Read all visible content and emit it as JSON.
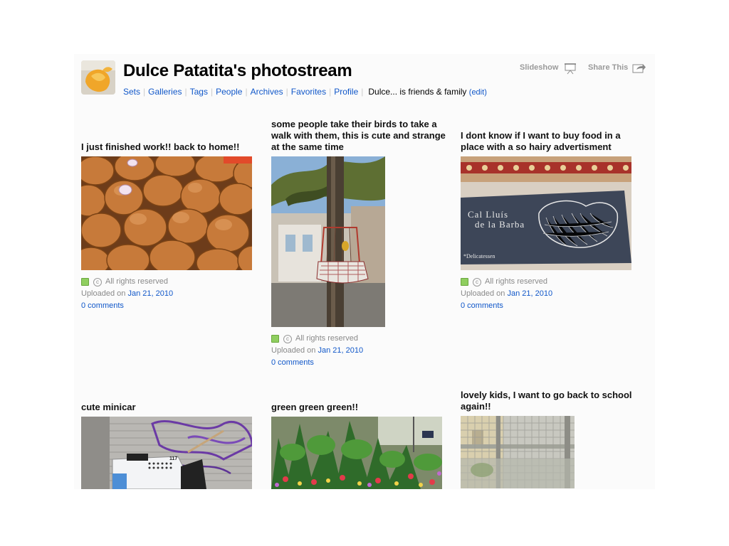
{
  "header": {
    "title": "Dulce Patatita's photostream",
    "nav": [
      "Sets",
      "Galleries",
      "Tags",
      "People",
      "Archives",
      "Favorites",
      "Profile"
    ],
    "relationship": "Dulce... is friends & family",
    "edit_label": "edit",
    "slideshow_label": "Slideshow",
    "share_label": "Share This"
  },
  "photos": [
    {
      "title": "I just finished work!! back to home!!",
      "rights": "All rights reserved",
      "uploaded_prefix": "Uploaded on",
      "uploaded_date": "Jan 21, 2010",
      "comments": "0 comments"
    },
    {
      "title": "some people take their birds to take a walk with them, this is cute and strange at the same time",
      "rights": "All rights reserved",
      "uploaded_prefix": "Uploaded on",
      "uploaded_date": "Jan 21, 2010",
      "comments": "0 comments"
    },
    {
      "title": "I dont know if I want to buy food in a place with a so hairy advertisment",
      "rights": "All rights reserved",
      "uploaded_prefix": "Uploaded on",
      "uploaded_date": "Jan 21, 2010",
      "comments": "0 comments",
      "sign_line1": "Cal Lluís",
      "sign_line2": "de la Barba",
      "sign_small": "*Delicatessen"
    },
    {
      "title": "cute minicar",
      "sign_number": "117"
    },
    {
      "title": "green green green!!"
    },
    {
      "title": "lovely kids, I want to go back to school again!!"
    }
  ],
  "colors": {
    "link": "#1057c9",
    "meta_grey": "#8a8a8a",
    "rights_green": "#8fce5f"
  }
}
